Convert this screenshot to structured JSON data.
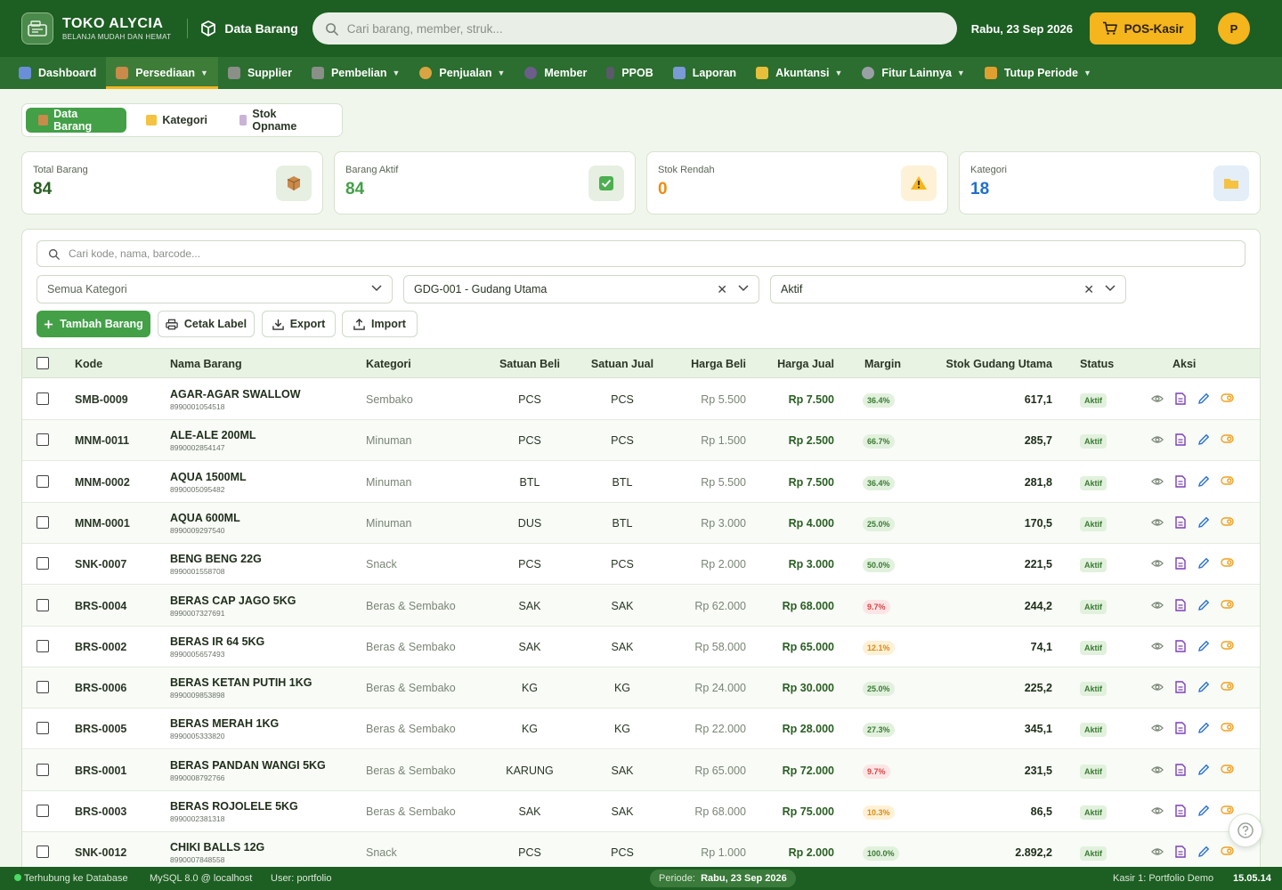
{
  "header": {
    "brand_name": "TOKO ALYCIA",
    "brand_tagline": "BELANJA MUDAH DAN HEMAT",
    "page_title": "Data Barang",
    "search_placeholder": "Cari barang, member, struk...",
    "date": "Rabu, 23 Sep 2026",
    "pos_label": "POS-Kasir",
    "avatar_initial": "P"
  },
  "nav": [
    {
      "label": "Dashboard",
      "dropdown": false,
      "color": "#6a8fd8"
    },
    {
      "label": "Persediaan",
      "dropdown": true,
      "active": true,
      "color": "#c98a4a"
    },
    {
      "label": "Supplier",
      "dropdown": false,
      "color": "#8a8f88"
    },
    {
      "label": "Pembelian",
      "dropdown": true,
      "color": "#8a8f88"
    },
    {
      "label": "Penjualan",
      "dropdown": true,
      "color": "#d9a441"
    },
    {
      "label": "Member",
      "dropdown": false,
      "color": "#6b5e8a"
    },
    {
      "label": "PPOB",
      "dropdown": false,
      "color": "#5a5a6a"
    },
    {
      "label": "Laporan",
      "dropdown": false,
      "color": "#7a9ad8"
    },
    {
      "label": "Akuntansi",
      "dropdown": true,
      "color": "#e6c03a"
    },
    {
      "label": "Fitur Lainnya",
      "dropdown": true,
      "color": "#9aa0a6"
    },
    {
      "label": "Tutup Periode",
      "dropdown": true,
      "color": "#e0a030"
    }
  ],
  "subtabs": [
    {
      "label": "Data Barang",
      "active": true
    },
    {
      "label": "Kategori",
      "active": false
    },
    {
      "label": "Stok Opname",
      "active": false
    }
  ],
  "stats": [
    {
      "label": "Total Barang",
      "value": "84",
      "color": "#2a5e23",
      "icon": "box-icon"
    },
    {
      "label": "Barang Aktif",
      "value": "84",
      "color": "#43a047",
      "icon": "check-icon"
    },
    {
      "label": "Stok Rendah",
      "value": "0",
      "color": "#f08c12",
      "icon": "warning-icon"
    },
    {
      "label": "Kategori",
      "value": "18",
      "color": "#1e6fd0",
      "icon": "folder-icon"
    }
  ],
  "filters": {
    "search_placeholder": "Cari kode, nama, barcode...",
    "kategori": "Semua Kategori",
    "gudang": "GDG-001 - Gudang Utama",
    "status": "Aktif"
  },
  "actions": {
    "tambah": "Tambah Barang",
    "cetak": "Cetak Label",
    "export": "Export",
    "import": "Import"
  },
  "table": {
    "headers": [
      "Kode",
      "Nama Barang",
      "Kategori",
      "Satuan Beli",
      "Satuan Jual",
      "Harga Beli",
      "Harga Jual",
      "Margin",
      "Stok Gudang Utama",
      "Status",
      "Aksi"
    ],
    "rows": [
      {
        "kode": "SMB-0009",
        "nama": "AGAR-AGAR SWALLOW",
        "barcode": "8990001054518",
        "kategori": "Sembako",
        "sbeli": "PCS",
        "sjual": "PCS",
        "hbeli": "Rp 5.500",
        "hjual": "Rp 7.500",
        "margin": "36.4%",
        "mlevel": "green",
        "stok": "617,1",
        "status": "Aktif"
      },
      {
        "kode": "MNM-0011",
        "nama": "ALE-ALE 200ML",
        "barcode": "8990002854147",
        "kategori": "Minuman",
        "sbeli": "PCS",
        "sjual": "PCS",
        "hbeli": "Rp 1.500",
        "hjual": "Rp 2.500",
        "margin": "66.7%",
        "mlevel": "green",
        "stok": "285,7",
        "status": "Aktif"
      },
      {
        "kode": "MNM-0002",
        "nama": "AQUA 1500ML",
        "barcode": "8990005095482",
        "kategori": "Minuman",
        "sbeli": "BTL",
        "sjual": "BTL",
        "hbeli": "Rp 5.500",
        "hjual": "Rp 7.500",
        "margin": "36.4%",
        "mlevel": "green",
        "stok": "281,8",
        "status": "Aktif"
      },
      {
        "kode": "MNM-0001",
        "nama": "AQUA 600ML",
        "barcode": "8990009297540",
        "kategori": "Minuman",
        "sbeli": "DUS",
        "sjual": "BTL",
        "hbeli": "Rp 3.000",
        "hjual": "Rp 4.000",
        "margin": "25.0%",
        "mlevel": "green",
        "stok": "170,5",
        "status": "Aktif"
      },
      {
        "kode": "SNK-0007",
        "nama": "BENG BENG 22G",
        "barcode": "8990001558708",
        "kategori": "Snack",
        "sbeli": "PCS",
        "sjual": "PCS",
        "hbeli": "Rp 2.000",
        "hjual": "Rp 3.000",
        "margin": "50.0%",
        "mlevel": "green",
        "stok": "221,5",
        "status": "Aktif"
      },
      {
        "kode": "BRS-0004",
        "nama": "BERAS CAP JAGO 5KG",
        "barcode": "8990007327691",
        "kategori": "Beras & Sembako",
        "sbeli": "SAK",
        "sjual": "SAK",
        "hbeli": "Rp 62.000",
        "hjual": "Rp 68.000",
        "margin": "9.7%",
        "mlevel": "red",
        "stok": "244,2",
        "status": "Aktif"
      },
      {
        "kode": "BRS-0002",
        "nama": "BERAS IR 64 5KG",
        "barcode": "8990005657493",
        "kategori": "Beras & Sembako",
        "sbeli": "SAK",
        "sjual": "SAK",
        "hbeli": "Rp 58.000",
        "hjual": "Rp 65.000",
        "margin": "12.1%",
        "mlevel": "orange",
        "stok": "74,1",
        "status": "Aktif"
      },
      {
        "kode": "BRS-0006",
        "nama": "BERAS KETAN PUTIH 1KG",
        "barcode": "8990009853898",
        "kategori": "Beras & Sembako",
        "sbeli": "KG",
        "sjual": "KG",
        "hbeli": "Rp 24.000",
        "hjual": "Rp 30.000",
        "margin": "25.0%",
        "mlevel": "green",
        "stok": "225,2",
        "status": "Aktif"
      },
      {
        "kode": "BRS-0005",
        "nama": "BERAS MERAH 1KG",
        "barcode": "8990005333820",
        "kategori": "Beras & Sembako",
        "sbeli": "KG",
        "sjual": "KG",
        "hbeli": "Rp 22.000",
        "hjual": "Rp 28.000",
        "margin": "27.3%",
        "mlevel": "green",
        "stok": "345,1",
        "status": "Aktif"
      },
      {
        "kode": "BRS-0001",
        "nama": "BERAS PANDAN WANGI 5KG",
        "barcode": "8990008792766",
        "kategori": "Beras & Sembako",
        "sbeli": "KARUNG",
        "sjual": "SAK",
        "hbeli": "Rp 65.000",
        "hjual": "Rp 72.000",
        "margin": "9.7%",
        "mlevel": "red",
        "stok": "231,5",
        "status": "Aktif"
      },
      {
        "kode": "BRS-0003",
        "nama": "BERAS ROJOLELE 5KG",
        "barcode": "8990002381318",
        "kategori": "Beras & Sembako",
        "sbeli": "SAK",
        "sjual": "SAK",
        "hbeli": "Rp 68.000",
        "hjual": "Rp 75.000",
        "margin": "10.3%",
        "mlevel": "orange",
        "stok": "86,5",
        "status": "Aktif"
      },
      {
        "kode": "SNK-0012",
        "nama": "CHIKI BALLS 12G",
        "barcode": "8990007848558",
        "kategori": "Snack",
        "sbeli": "PCS",
        "sjual": "PCS",
        "hbeli": "Rp 1.000",
        "hjual": "Rp 2.000",
        "margin": "100.0%",
        "mlevel": "green",
        "stok": "2.892,2",
        "status": "Aktif"
      }
    ]
  },
  "footer": {
    "connection": "Terhubung ke Database",
    "db": "MySQL 8.0 @ localhost",
    "user": "User: portfolio",
    "periode_label": "Periode:",
    "periode_value": "Rabu, 23 Sep 2026",
    "kasir": "Kasir 1: Portfolio Demo",
    "time": "15.05.14"
  }
}
